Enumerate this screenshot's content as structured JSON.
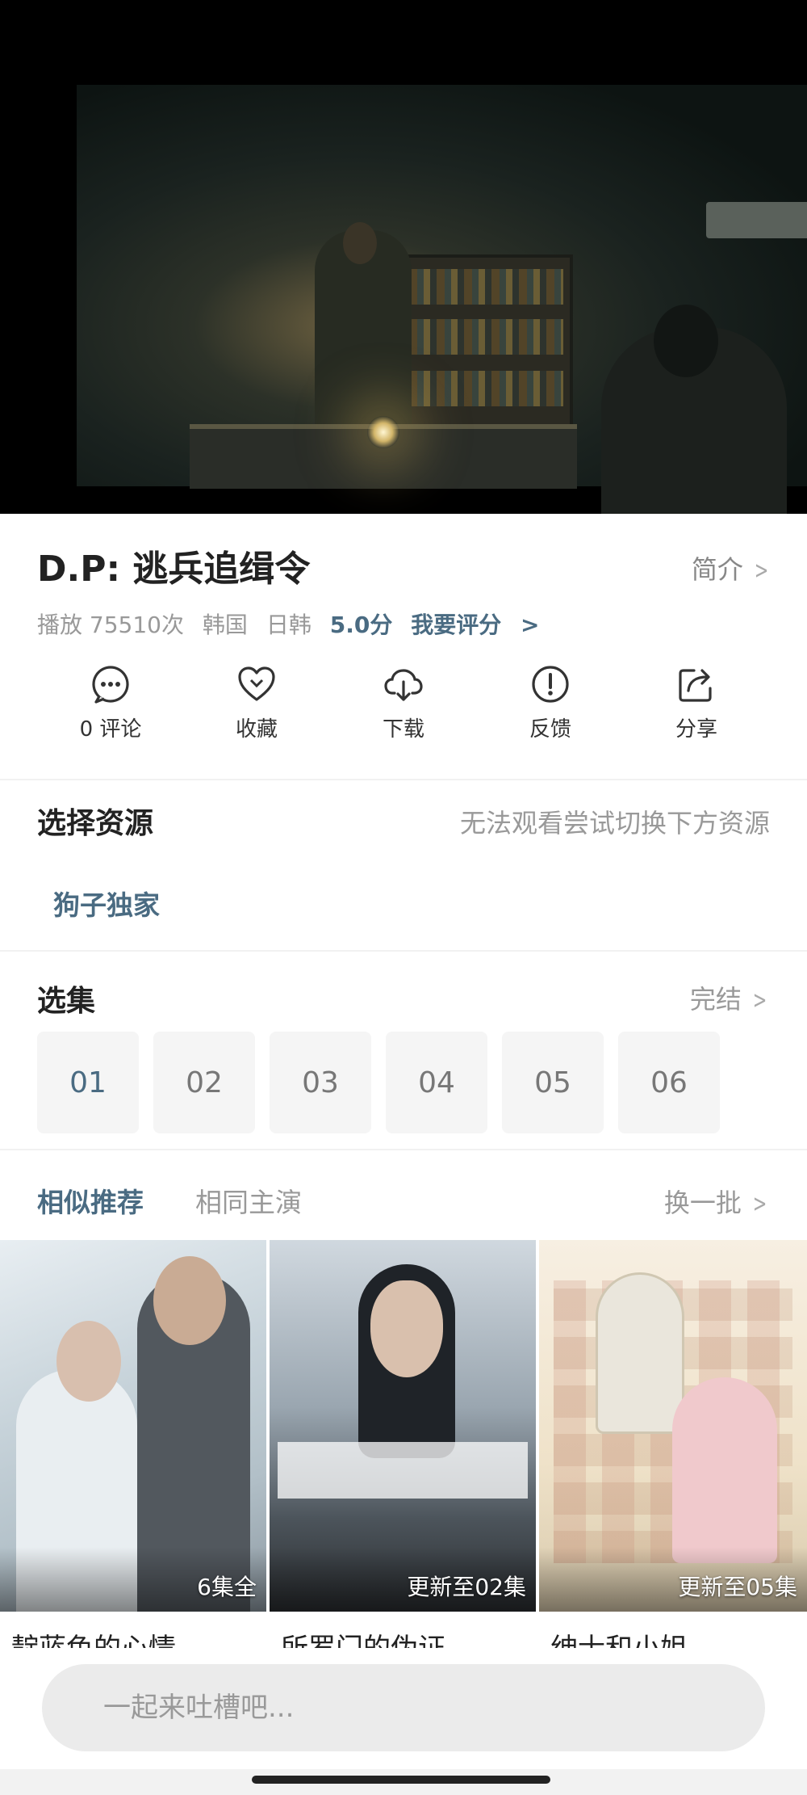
{
  "video": {
    "description_icon": "video-frame"
  },
  "header": {
    "title": "D.P: 逃兵追缉令",
    "intro_label": "简介"
  },
  "meta": {
    "plays": "播放 75510次",
    "region": "韩国",
    "genre": "日韩",
    "score": "5.0分",
    "rate_label": "我要评分"
  },
  "actions": [
    {
      "icon": "comment-icon",
      "label": "0 评论"
    },
    {
      "icon": "heart-icon",
      "label": "收藏"
    },
    {
      "icon": "download-icon",
      "label": "下载"
    },
    {
      "icon": "feedback-icon",
      "label": "反馈"
    },
    {
      "icon": "share-icon",
      "label": "分享"
    }
  ],
  "source_section": {
    "title": "选择资源",
    "hint": "无法观看尝试切换下方资源",
    "sources": [
      "狗子独家"
    ]
  },
  "episodes_section": {
    "title": "选集",
    "status": "完结",
    "episodes": [
      "01",
      "02",
      "03",
      "04",
      "05",
      "06"
    ],
    "active": "01"
  },
  "recommend": {
    "tabs": [
      "相似推荐",
      "相同主演"
    ],
    "refresh_label": "换一批",
    "items": [
      {
        "title": "靛蓝色的心情",
        "badge": "6集全"
      },
      {
        "title": "所罗门的伪证",
        "badge": "更新至02集"
      },
      {
        "title": "绅士和小姐",
        "badge": "更新至05集"
      }
    ]
  },
  "comment_bar": {
    "placeholder": "一起来吐槽吧..."
  },
  "colors": {
    "accent": "#4a6b82",
    "muted": "#999999",
    "tile_bg": "#f5f5f5"
  }
}
